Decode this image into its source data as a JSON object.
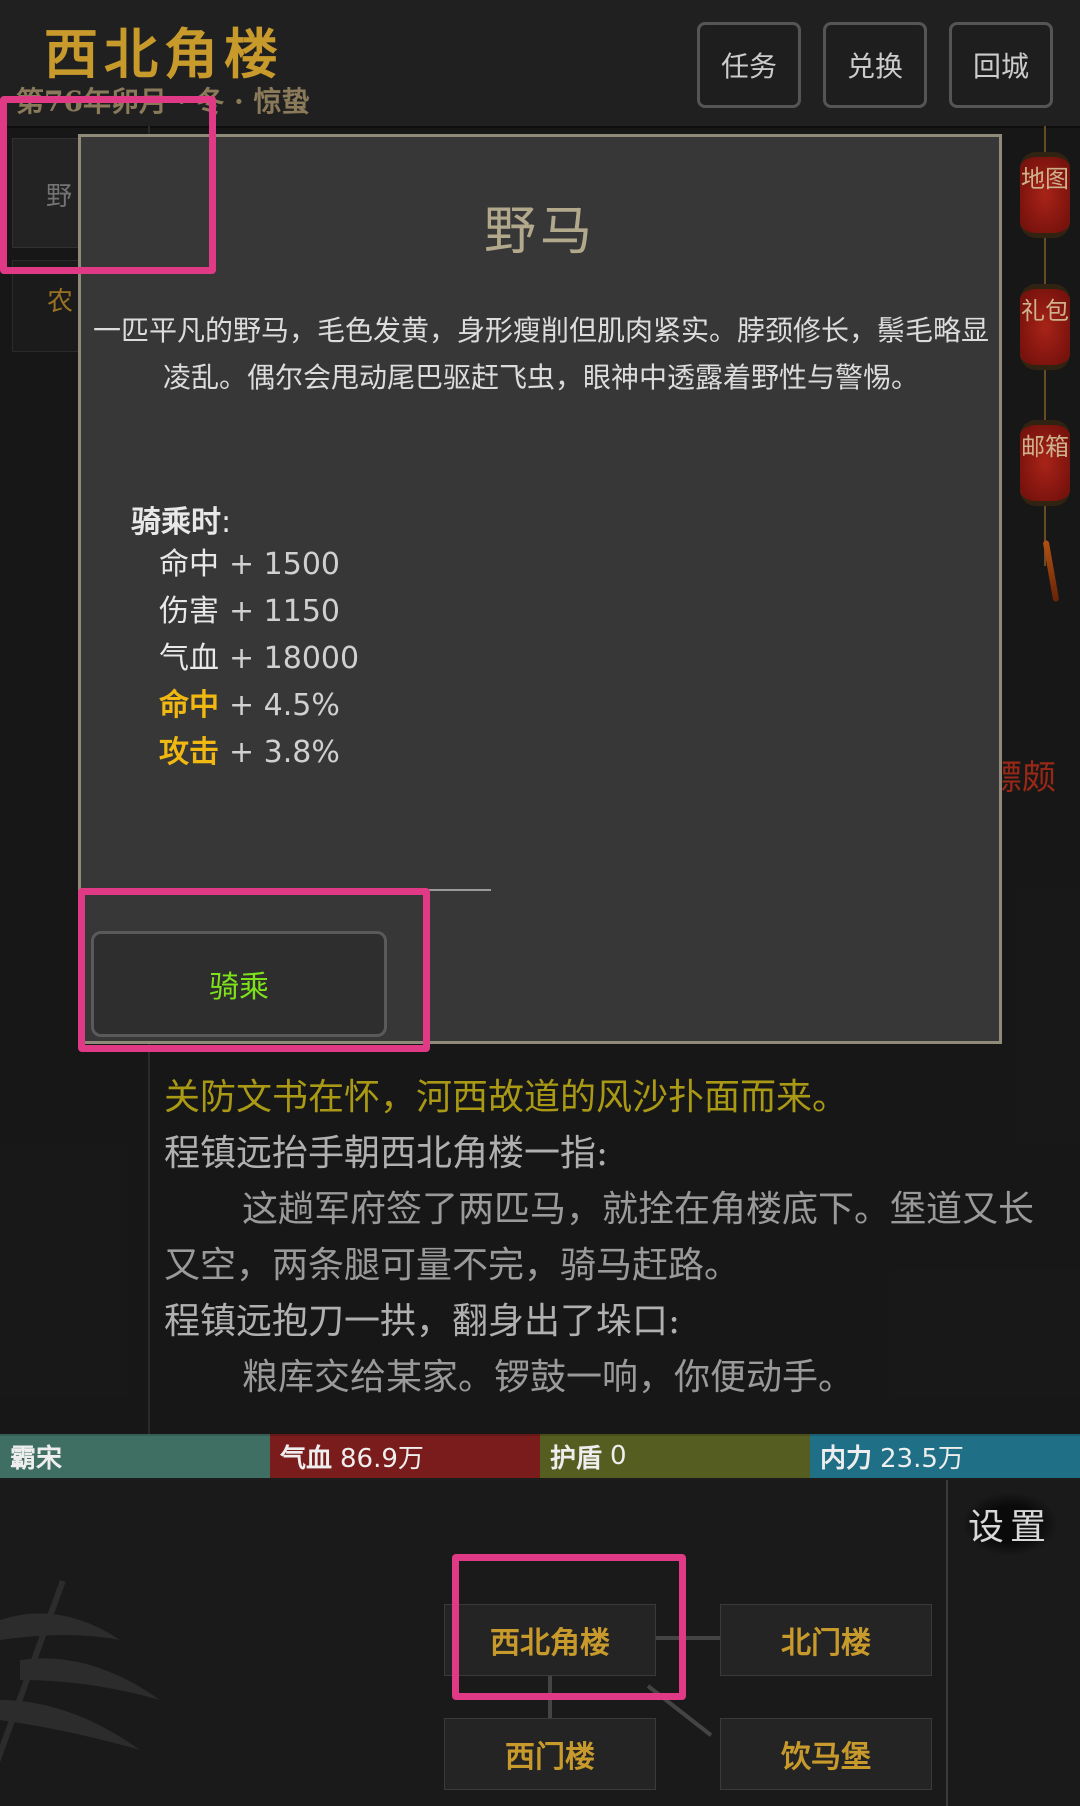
{
  "header": {
    "location_title": "西北角楼",
    "date_text": "第76年卯月 · 冬 · 惊蛰",
    "buttons": {
      "quest": "任务",
      "exchange": "兑换",
      "return_city": "回城"
    }
  },
  "left_panel": {
    "tab1": "野",
    "tab2": "农"
  },
  "lanterns": {
    "map": "地图",
    "gift": "礼包",
    "mail": "邮箱"
  },
  "background_fragments": {
    "right_char": "骠颇"
  },
  "modal": {
    "title": "野马",
    "description": "一匹平凡的野马，毛色发黄，身形瘦削但肌肉紧实。脖颈修长，鬃毛略显凌乱。偶尔会甩动尾巴驱赶飞虫，眼神中透露着野性与警惕。",
    "riding_label": "骑乘时",
    "riding_colon": ":",
    "stats": [
      {
        "name": "命中",
        "value": "+ 1500",
        "highlight": false
      },
      {
        "name": "伤害",
        "value": "+ 1150",
        "highlight": false
      },
      {
        "name": "气血",
        "value": "+ 18000",
        "highlight": false
      },
      {
        "name": "命中",
        "value": "+ 4.5%",
        "highlight": true
      },
      {
        "name": "攻击",
        "value": "+ 3.8%",
        "highlight": true
      }
    ],
    "ride_button": "骑乘"
  },
  "story": {
    "narration": "关防文书在怀，河西故道的风沙扑面而来。",
    "speaker1": "程镇远抬手朝西北角楼一指:",
    "line1": "这趟军府签了两匹马，就拴在角楼底下。堡道又长又空，两条腿可量不完，骑马赶路。",
    "speaker2": "程镇远抱刀一拱，翻身出了垛口:",
    "line2": "粮库交给某家。锣鼓一响，你便动手。"
  },
  "status": {
    "player_name": "霸宋",
    "hp_label": "气血",
    "hp_value": "86.9万",
    "shield_label": "护盾",
    "shield_value": "0",
    "mp_label": "内力",
    "mp_value": "23.5万"
  },
  "map": {
    "settings": "设置",
    "current": "西北角楼",
    "north_gate": "北门楼",
    "west_gate": "西门楼",
    "horse_fort": "饮马堡"
  },
  "colors": {
    "gold": "#c89a2c",
    "highlight_pink": "#e03a86",
    "stat_gold": "#f0b810",
    "ride_green": "#7ee21a",
    "hp_red": "#7a1c1c",
    "mp_blue": "#1f6f86"
  }
}
